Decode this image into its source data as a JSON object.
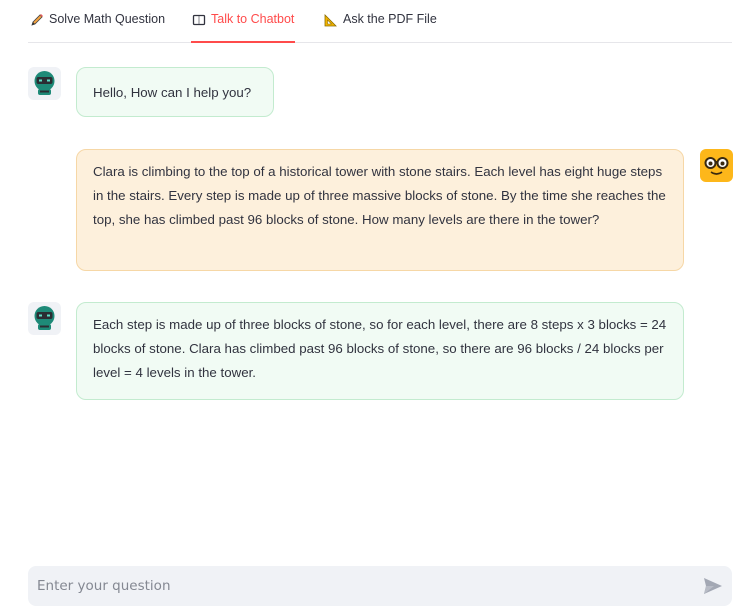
{
  "tabs": [
    {
      "label": "Solve Math Question",
      "icon": "pencil-icon"
    },
    {
      "label": "Talk to Chatbot",
      "icon": "book-icon",
      "active": true
    },
    {
      "label": "Ask the PDF File",
      "icon": "triangle-ruler-icon"
    }
  ],
  "messages": [
    {
      "role": "assistant",
      "text": "Hello, How can I help you?"
    },
    {
      "role": "user",
      "text": "Clara is climbing to the top of a historical tower with stone stairs. Each level has eight huge steps in the stairs. Every step is made up of three massive blocks of stone. By the time she reaches the top, she has climbed past 96 blocks of stone. How many levels are there in the tower?"
    },
    {
      "role": "assistant",
      "text": "Each step is made up of three blocks of stone, so for each level, there are 8 steps x 3 blocks = 24 blocks of stone. Clara has climbed past 96 blocks of stone, so there are 96 blocks / 24 blocks per level = 4 levels in the tower."
    }
  ],
  "input": {
    "placeholder": "Enter your question",
    "value": ""
  },
  "colors": {
    "accent": "#ff4b4b",
    "assistant_bubble": "#f1fbf4",
    "user_bubble": "#fdf0dc",
    "user_avatar": "#fdb71a",
    "bot_avatar": "#1e8a78"
  }
}
